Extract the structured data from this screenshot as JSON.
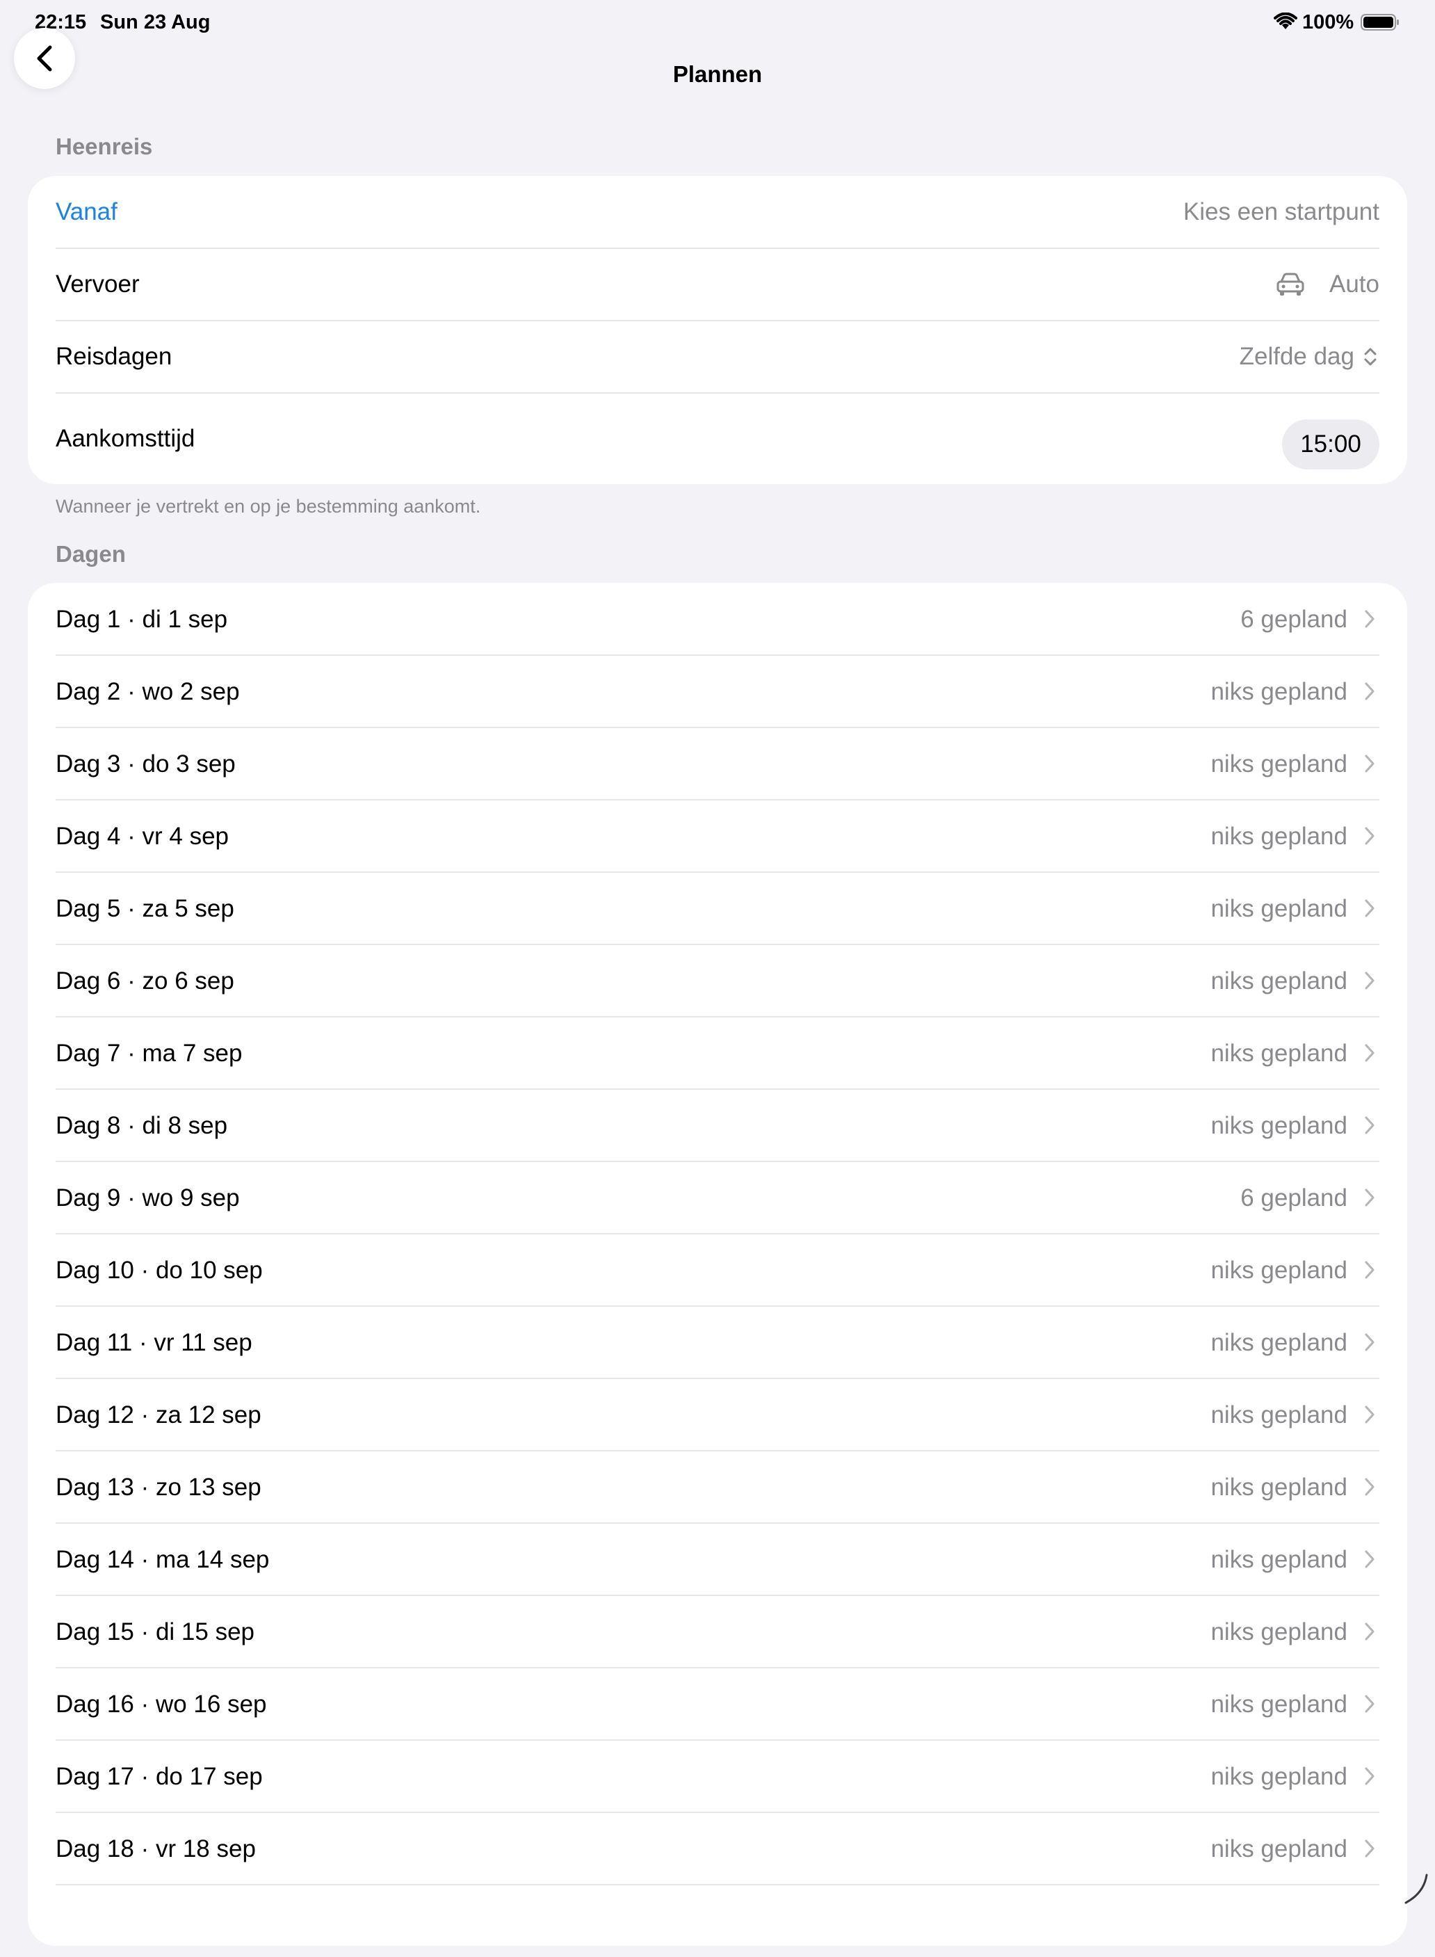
{
  "status_bar": {
    "time": "22:15",
    "date": "Sun 23 Aug",
    "battery": "100%"
  },
  "nav": {
    "title": "Plannen",
    "back_icon": "chevron-left-icon"
  },
  "outbound": {
    "header": "Heenreis",
    "from_label": "Vanaf",
    "from_placeholder": "Kies een startpunt",
    "transport_label": "Vervoer",
    "transport_value": "Auto",
    "transport_icon": "car-icon",
    "travel_days_label": "Reisdagen",
    "travel_days_value": "Zelfde dag",
    "arrival_label": "Aankomsttijd",
    "arrival_value": "15:00",
    "footer": "Wanneer je vertrekt en op je bestemming aankomt."
  },
  "days": {
    "header": "Dagen",
    "items": [
      {
        "label": "Dag 1 · di 1 sep",
        "status": "6 gepland"
      },
      {
        "label": "Dag 2 · wo 2 sep",
        "status": "niks gepland"
      },
      {
        "label": "Dag 3 · do 3 sep",
        "status": "niks gepland"
      },
      {
        "label": "Dag 4 · vr 4 sep",
        "status": "niks gepland"
      },
      {
        "label": "Dag 5 · za 5 sep",
        "status": "niks gepland"
      },
      {
        "label": "Dag 6 · zo 6 sep",
        "status": "niks gepland"
      },
      {
        "label": "Dag 7 · ma 7 sep",
        "status": "niks gepland"
      },
      {
        "label": "Dag 8 · di 8 sep",
        "status": "niks gepland"
      },
      {
        "label": "Dag 9 · wo 9 sep",
        "status": "6 gepland"
      },
      {
        "label": "Dag 10 · do 10 sep",
        "status": "niks gepland"
      },
      {
        "label": "Dag 11 · vr 11 sep",
        "status": "niks gepland"
      },
      {
        "label": "Dag 12 · za 12 sep",
        "status": "niks gepland"
      },
      {
        "label": "Dag 13 · zo 13 sep",
        "status": "niks gepland"
      },
      {
        "label": "Dag 14 · ma 14 sep",
        "status": "niks gepland"
      },
      {
        "label": "Dag 15 · di 15 sep",
        "status": "niks gepland"
      },
      {
        "label": "Dag 16 · wo 16 sep",
        "status": "niks gepland"
      },
      {
        "label": "Dag 17 · do 17 sep",
        "status": "niks gepland"
      },
      {
        "label": "Dag 18 · vr 18 sep",
        "status": "niks gepland"
      }
    ]
  },
  "colors": {
    "accent": "#1a82e2",
    "background": "#f2f2f7",
    "secondary_text": "#8a8a8e"
  }
}
